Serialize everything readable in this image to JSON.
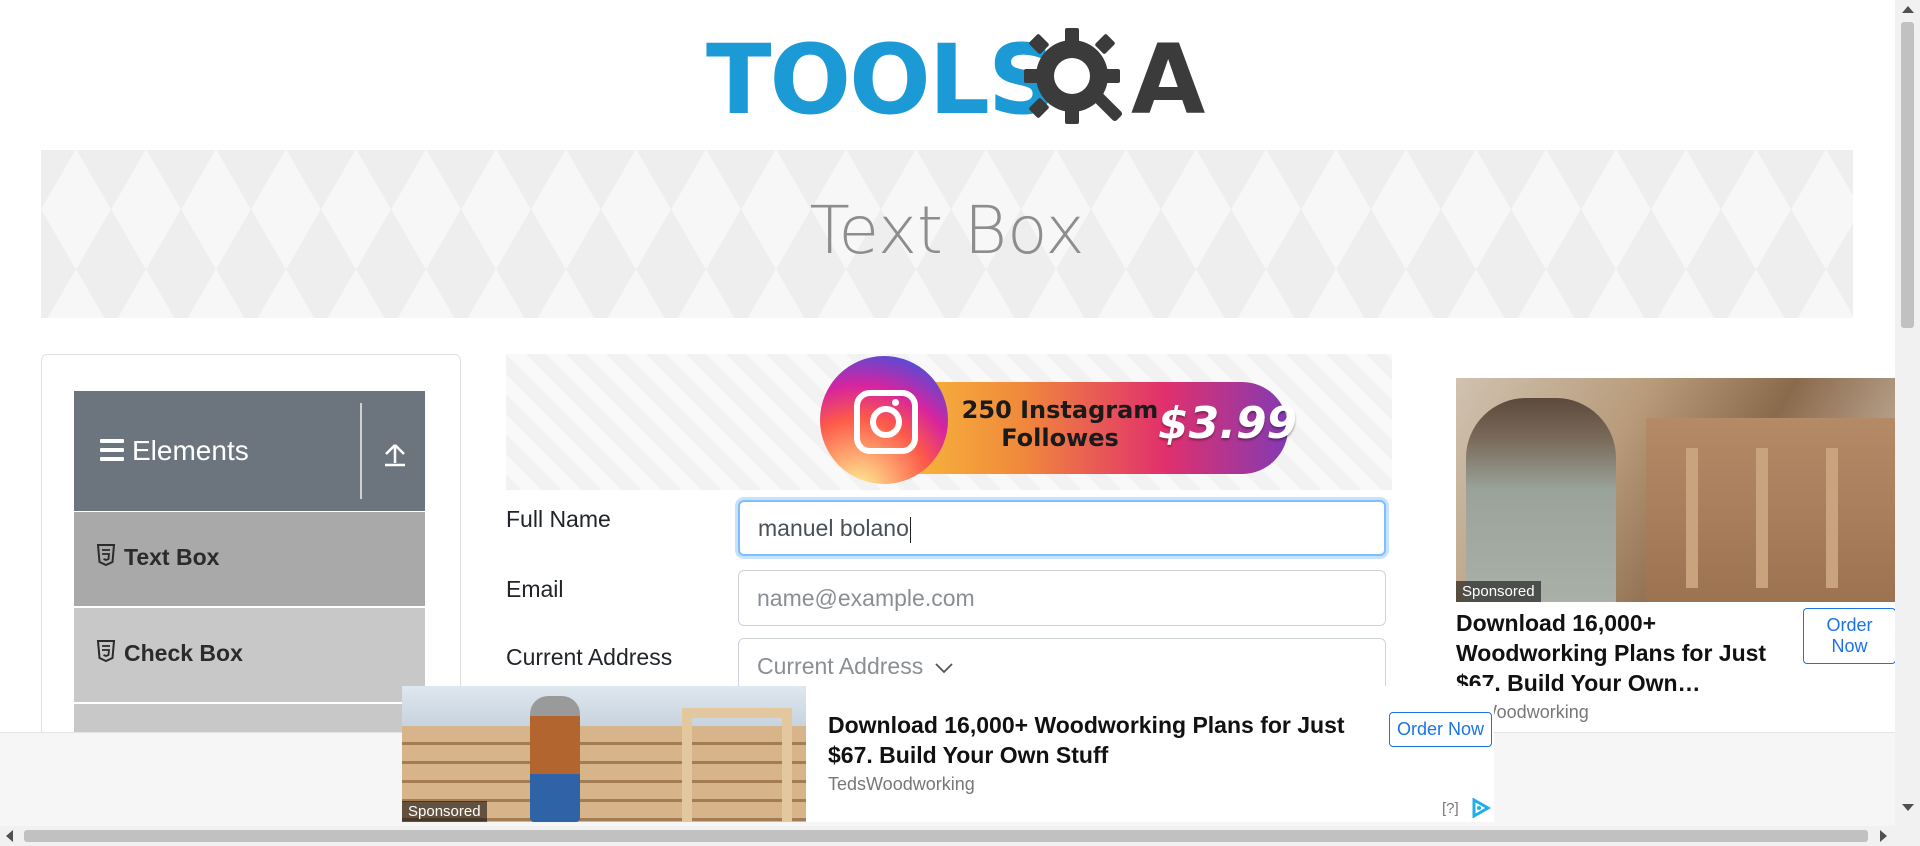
{
  "header": {
    "logo_text_left": "TOOLS",
    "logo_text_right": "A",
    "logo_icon": "gear-magnifier-icon"
  },
  "banner": {
    "title": "Text Box"
  },
  "sidebar": {
    "group_title": "Elements",
    "group_icon": "hamburger-icon",
    "collapse_icon": "collapse-arrow-icon",
    "items": [
      {
        "label": "Text Box",
        "icon": "html5-icon"
      },
      {
        "label": "Check Box",
        "icon": "html5-icon"
      }
    ]
  },
  "top_ad": {
    "line1": "250 Instagram",
    "line2": "Followes",
    "price": "$3.99",
    "icon": "instagram-icon"
  },
  "form": {
    "full_name_label": "Full Name",
    "full_name_value": "manuel bolano",
    "email_label": "Email",
    "email_placeholder": "name@example.com",
    "address_label": "Current Address",
    "address_placeholder": "Current Address"
  },
  "right_ad": {
    "sponsored": "Sponsored",
    "headline": "Download 16,000+ Woodworking Plans for Just $67. Build Your Own…",
    "source": "Woodworking",
    "cta": "Order Now"
  },
  "bottom_ad": {
    "sponsored": "Sponsored",
    "headline": "Download 16,000+ Woodworking Plans for Just $67. Build Your Own Stuff",
    "source": "TedsWoodworking",
    "cta": "Order Now",
    "help": "[?]",
    "adchoices_icon": "adchoices-icon"
  }
}
